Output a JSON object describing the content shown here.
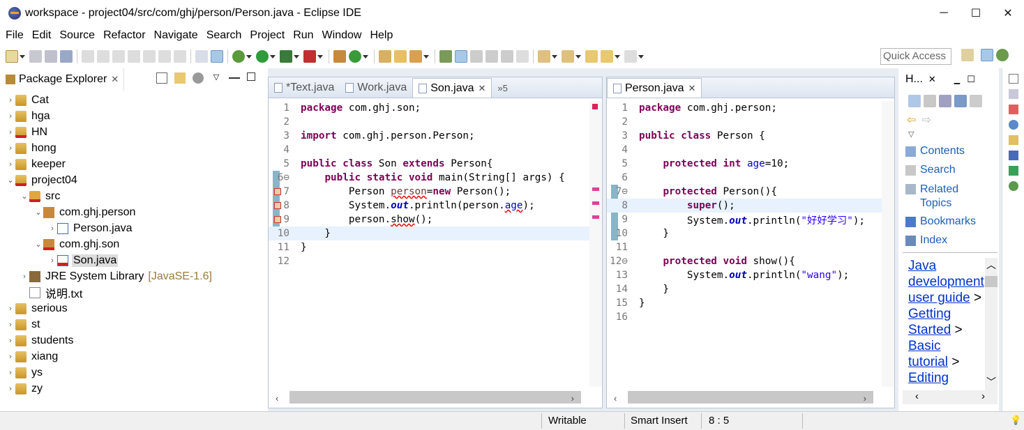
{
  "window": {
    "title": "workspace - project04/src/com/ghj/person/Person.java - Eclipse IDE",
    "minimize": "─",
    "maximize": "☐",
    "close": "✕"
  },
  "menu": [
    "File",
    "Edit",
    "Source",
    "Refactor",
    "Navigate",
    "Search",
    "Project",
    "Run",
    "Window",
    "Help"
  ],
  "quick_access": "Quick Access",
  "package_explorer": {
    "title": "Package Explorer",
    "tree": [
      {
        "label": "Cat",
        "indent": 0,
        "arrow": "›",
        "icon": "project-icon"
      },
      {
        "label": "hga",
        "indent": 0,
        "arrow": "›",
        "icon": "project-icon"
      },
      {
        "label": "HN",
        "indent": 0,
        "arrow": "›",
        "icon": "project-error-icon"
      },
      {
        "label": "hong",
        "indent": 0,
        "arrow": "›",
        "icon": "project-icon"
      },
      {
        "label": "keeper",
        "indent": 0,
        "arrow": "›",
        "icon": "project-icon"
      },
      {
        "label": "project04",
        "indent": 0,
        "arrow": "⌄",
        "icon": "project-error-icon"
      },
      {
        "label": "src",
        "indent": 1,
        "arrow": "⌄",
        "icon": "source-folder-icon"
      },
      {
        "label": "com.ghj.person",
        "indent": 2,
        "arrow": "⌄",
        "icon": "package-icon"
      },
      {
        "label": "Person.java",
        "indent": 3,
        "arrow": "›",
        "icon": "java-file-icon"
      },
      {
        "label": "com.ghj.son",
        "indent": 2,
        "arrow": "⌄",
        "icon": "package-error-icon"
      },
      {
        "label": "Son.java",
        "indent": 3,
        "arrow": "›",
        "icon": "java-file-error-icon",
        "selected": true
      },
      {
        "label": "JRE System Library",
        "indent": 1,
        "arrow": "›",
        "icon": "library-icon",
        "decoration": "[JavaSE-1.6]"
      },
      {
        "label": "说明.txt",
        "indent": 1,
        "arrow": "",
        "icon": "text-file-icon"
      },
      {
        "label": "serious",
        "indent": 0,
        "arrow": "›",
        "icon": "project-icon"
      },
      {
        "label": "st",
        "indent": 0,
        "arrow": "›",
        "icon": "project-icon"
      },
      {
        "label": "students",
        "indent": 0,
        "arrow": "›",
        "icon": "project-icon"
      },
      {
        "label": "xiang",
        "indent": 0,
        "arrow": "›",
        "icon": "project-icon"
      },
      {
        "label": "ys",
        "indent": 0,
        "arrow": "›",
        "icon": "project-icon"
      },
      {
        "label": "zy",
        "indent": 0,
        "arrow": "›",
        "icon": "project-icon"
      }
    ]
  },
  "editor_left": {
    "tabs": [
      {
        "label": "*Text.java",
        "active": false
      },
      {
        "label": "Work.java",
        "active": false
      },
      {
        "label": "Son.java",
        "active": true
      }
    ],
    "overflow": "»5",
    "lines": [
      {
        "n": "1",
        "html": "<span class='k'>package</span> com.ghj.son;"
      },
      {
        "n": "2",
        "html": ""
      },
      {
        "n": "3",
        "html": "<span class='k'>import</span> com.ghj.person.Person;"
      },
      {
        "n": "4",
        "html": ""
      },
      {
        "n": "5",
        "html": "<span class='k'>public class</span> Son <span class='k'>extends</span> Person{"
      },
      {
        "n": "6⊖",
        "html": "    <span class='k'>public static</span> <span class='k'>void</span> main(String[] args) {"
      },
      {
        "n": "7",
        "html": "        Person <span class='v err'>person</span>=<span class='k'>new</span> Person();"
      },
      {
        "n": "8",
        "html": "        System.<span class='f'>out</span>.println(person.<span class='fld err'>age</span>);"
      },
      {
        "n": "9",
        "html": "        person.<span class='err'>show</span>();"
      },
      {
        "n": "10",
        "html": "    }",
        "hl": true
      },
      {
        "n": "11",
        "html": "}"
      },
      {
        "n": "12",
        "html": ""
      }
    ]
  },
  "editor_right": {
    "tabs": [
      {
        "label": "Person.java",
        "active": true
      }
    ],
    "lines": [
      {
        "n": "1",
        "html": "<span class='k'>package</span> com.ghj.person;"
      },
      {
        "n": "2",
        "html": ""
      },
      {
        "n": "3",
        "html": "<span class='k'>public class</span> Person {"
      },
      {
        "n": "4",
        "html": ""
      },
      {
        "n": "5",
        "html": "    <span class='k'>protected int</span> <span class='fld'>age</span>=10;"
      },
      {
        "n": "6",
        "html": ""
      },
      {
        "n": "7⊖",
        "html": "    <span class='k'>protected</span> Person(){"
      },
      {
        "n": "8",
        "html": "        <span class='k'>super</span>();",
        "hl": true
      },
      {
        "n": "9",
        "html": "        System.<span class='f'>out</span>.println(<span class='s'>\"好好学习\"</span>);"
      },
      {
        "n": "10",
        "html": "    }"
      },
      {
        "n": "11",
        "html": ""
      },
      {
        "n": "12⊖",
        "html": "    <span class='k'>protected void</span> show(){"
      },
      {
        "n": "13",
        "html": "        System.<span class='f'>out</span>.println(<span class='s'>\"wang\"</span>);"
      },
      {
        "n": "14",
        "html": "    }"
      },
      {
        "n": "15",
        "html": "}"
      },
      {
        "n": "16",
        "html": ""
      }
    ]
  },
  "help": {
    "title": "H...",
    "items": [
      "Contents",
      "Search",
      "Related Topics",
      "Bookmarks",
      "Index"
    ],
    "content": {
      "link1": "Java development user guide",
      "sep": ">",
      "link2": "Getting Started",
      "link3": "Basic tutorial",
      "link4": "Editing"
    }
  },
  "status": {
    "writable": "Writable",
    "insert_mode": "Smart Insert",
    "position": "8 : 5"
  }
}
